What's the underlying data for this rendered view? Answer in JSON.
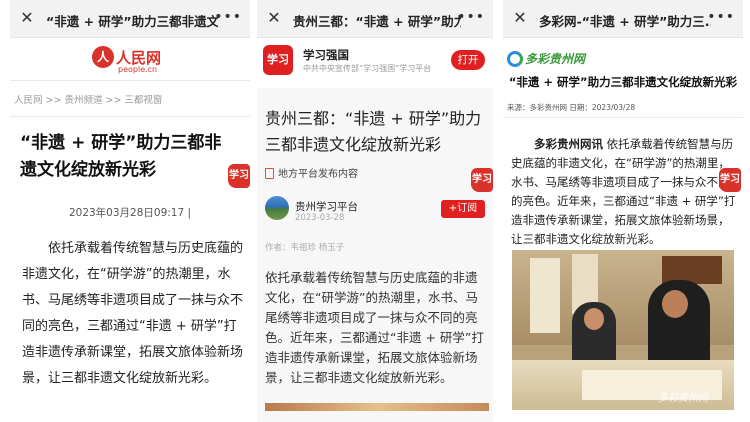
{
  "panel1": {
    "window_title": "“非遗 + 研学”助力三都非遗文...",
    "logo_name": "人民网",
    "logo_url": "people.cn",
    "breadcrumb": "人民网 >> 贵州频道 >> 三都视窗",
    "article_title": "“非遗 + 研学”助力三都非遗文化绽放新光彩",
    "date": "2023年03月28日09:17 |",
    "body": "依托承载着传统智慧与历史底蕴的非遗文化，在“研学游”的热潮里，水书、马尾绣等非遗项目成了一抹与众不同的亮色，三都通过“非遗 + 研学”打造非遗传承新课堂，拓展文旅体验新场景，让三都非遗文化绽放新光彩。",
    "seal_text": "学习"
  },
  "panel2": {
    "window_title": "贵州三都：“非遗 + 研学”助力...",
    "app_icon_text": "学习",
    "app_name": "学习强国",
    "app_desc": "中共中央宣传部“学习强国”学习平台",
    "open_label": "打开",
    "article_title": "贵州三都：“非遗 + 研学”助力三都非遗文化绽放新光彩",
    "publish_note": "地方平台发布内容",
    "account_name": "贵州学习平台",
    "account_date": "2023-03-28",
    "subscribe_label": "+订阅",
    "author": "作者：韦祖珍  杨玉子",
    "body": "依托承载着传统智慧与历史底蕴的非遗文化，在“研学游”的热潮里，水书、马尾绣等非遗项目成了一抹与众不同的亮色。近年来，三都通过“非遗 + 研学”打造非遗传承新课堂，拓展文旅体验新场景，让三都非遗文化绽放新光彩。",
    "seal_text": "学习"
  },
  "panel3": {
    "window_title": "多彩网-“非遗 + 研学”助力三...",
    "logo_text": "多彩贵州网",
    "article_title": "“非遗 + 研学”助力三都非遗文化绽放新光彩",
    "meta": "来源：多彩贵州网    日期：2023/03/28",
    "lead": "多彩贵州网讯",
    "body": " 依托承载着传统智慧与历史底蕴的非遗文化，在“研学游”的热潮里，水书、马尾绣等非遗项目成了一抹与众不同的亮色。近年来，三都通过“非遗 + 研学”打造非遗传承新课堂，拓展文旅体验新场景，让三都非遗文化绽放新光彩。",
    "photo_watermark": "多彩贵州网",
    "seal_text": "学习"
  },
  "icons": {
    "close": "close-icon",
    "more": "more-icon"
  },
  "colors": {
    "accent_red": "#e02020",
    "people_red": "#d9322a",
    "duocai_green": "#3a9a3a"
  }
}
